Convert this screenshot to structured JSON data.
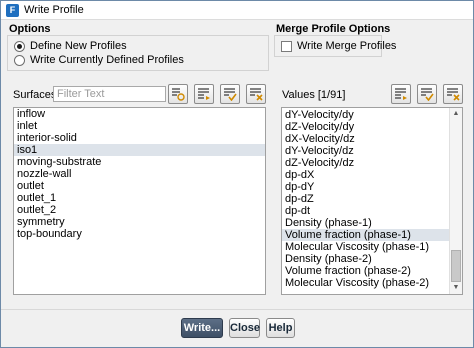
{
  "window": {
    "title": "Write Profile",
    "app_icon_glyph": "F"
  },
  "options": {
    "heading": "Options",
    "radios": [
      {
        "label": "Define New Profiles",
        "selected": true
      },
      {
        "label": "Write Currently Defined Profiles",
        "selected": false
      }
    ]
  },
  "merge": {
    "heading": "Merge Profile Options",
    "checkbox_label": "Write Merge Profiles",
    "checked": false
  },
  "surfaces": {
    "label": "Surfaces",
    "filter_placeholder": "Filter Text",
    "items": [
      "inflow",
      "inlet",
      "interior-solid",
      "iso1",
      "moving-substrate",
      "nozzle-wall",
      "outlet",
      "outlet_1",
      "outlet_2",
      "symmetry",
      "top-boundary"
    ],
    "selected_index": 3,
    "toolbar_icons": [
      "filter-icon",
      "select-icon",
      "select-all-icon",
      "deselect-all-icon"
    ]
  },
  "values": {
    "label": "Values [1/91]",
    "items": [
      "dY-Velocity/dy",
      "dZ-Velocity/dy",
      "dX-Velocity/dz",
      "dY-Velocity/dz",
      "dZ-Velocity/dz",
      "dp-dX",
      "dp-dY",
      "dp-dZ",
      "dp-dt",
      "Density (phase-1)",
      "Volume fraction (phase-1)",
      "Molecular Viscosity (phase-1)",
      "Density (phase-2)",
      "Volume fraction (phase-2)",
      "Molecular Viscosity (phase-2)"
    ],
    "selected_index": 10,
    "toolbar_icons": [
      "select-icon",
      "select-all-icon",
      "deselect-all-icon"
    ]
  },
  "buttons": {
    "write": "Write...",
    "close": "Close",
    "help": "Help"
  },
  "colors": {
    "accent": "#1f6fbf",
    "selection": "#dde3ea",
    "primary_button": "#4a5b72"
  }
}
